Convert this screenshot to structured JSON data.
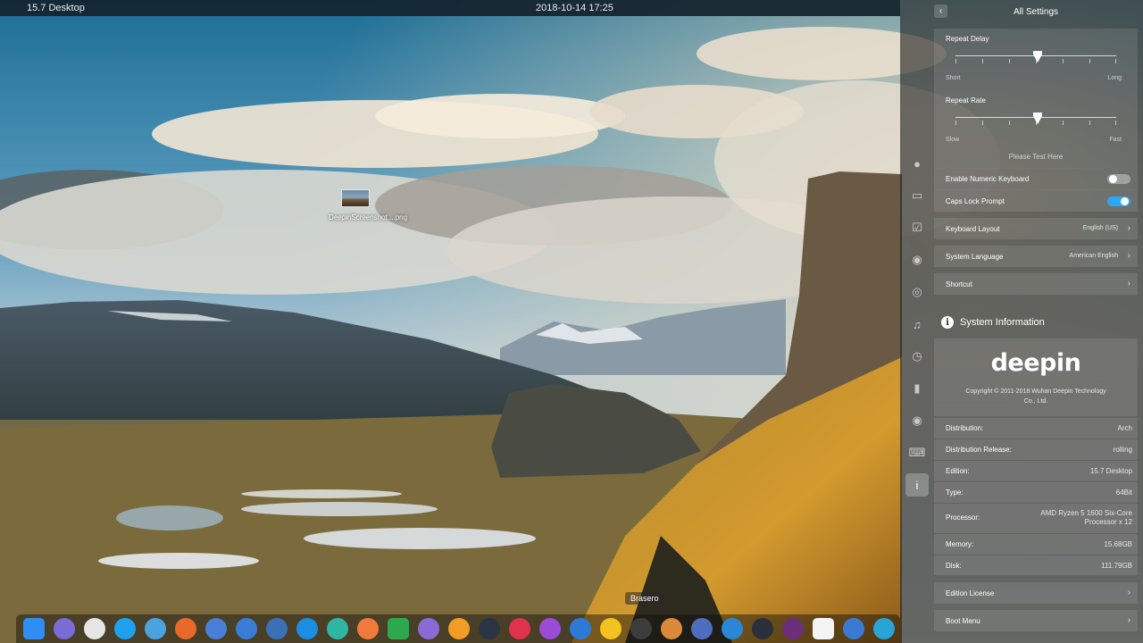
{
  "topbar": {
    "left_text": "15.7 Desktop",
    "datetime": "2018-10-14 17:25"
  },
  "desktop": {
    "file_icon_label": "DeepinScreenshot....png"
  },
  "dock": {
    "tooltip": "Brasero",
    "apps": [
      {
        "name": "launcher-icon",
        "color": "#2f8ef4"
      },
      {
        "name": "file-manager-icon",
        "color": "#7a6bd6"
      },
      {
        "name": "disc-icon",
        "color": "#e6e6e6"
      },
      {
        "name": "skype-icon",
        "color": "#1ea1f1"
      },
      {
        "name": "messenger-icon",
        "color": "#4aa3df"
      },
      {
        "name": "firefox-icon",
        "color": "#e8692a"
      },
      {
        "name": "chromium-icon",
        "color": "#4a7fd8"
      },
      {
        "name": "qbittorrent-icon",
        "color": "#3a7bd5"
      },
      {
        "name": "network-icon",
        "color": "#3b6fb6"
      },
      {
        "name": "teamviewer-icon",
        "color": "#1a8ee0"
      },
      {
        "name": "notes-icon",
        "color": "#2eb5a4"
      },
      {
        "name": "image-viewer-icon",
        "color": "#f07a3c"
      },
      {
        "name": "spreadsheet-icon",
        "color": "#2ea84d"
      },
      {
        "name": "document-icon",
        "color": "#8a6bd3"
      },
      {
        "name": "store-icon",
        "color": "#f39c25"
      },
      {
        "name": "kodi-icon",
        "color": "#2a3442"
      },
      {
        "name": "game-icon",
        "color": "#e0324a"
      },
      {
        "name": "music-player-icon",
        "color": "#9a4cd6"
      },
      {
        "name": "media-player-icon",
        "color": "#2c7ad6"
      },
      {
        "name": "video-icon",
        "color": "#f4c21f"
      },
      {
        "name": "brasero-icon",
        "color": "#3c3c3c"
      },
      {
        "name": "gimp-icon",
        "color": "#d88a3a"
      },
      {
        "name": "drawing-icon",
        "color": "#4e6dbd"
      },
      {
        "name": "cloud-icon",
        "color": "#2c86d6"
      },
      {
        "name": "steam-icon",
        "color": "#2a2f3a"
      },
      {
        "name": "podcast-icon",
        "color": "#6b2f7a"
      },
      {
        "name": "windows-app-icon",
        "color": "#f4f4f4"
      },
      {
        "name": "remote-desktop-icon",
        "color": "#3a7ad3"
      },
      {
        "name": "system-monitor-icon",
        "color": "#2aa4d6"
      }
    ]
  },
  "panel": {
    "back_icon": "chevron-left-icon",
    "title": "All Settings",
    "repeat_delay": {
      "label": "Repeat Delay",
      "min_label": "Short",
      "max_label": "Long",
      "level": 0.5
    },
    "repeat_rate": {
      "label": "Repeat Rate",
      "min_label": "Slow",
      "max_label": "Fast",
      "level": 0.5
    },
    "test_placeholder": "Please Test Here",
    "numeric_keyboard": {
      "label": "Enable Numeric Keyboard",
      "on": false
    },
    "caps_lock": {
      "label": "Caps Lock Prompt",
      "on": true
    },
    "keyboard_layout": {
      "label": "Keyboard Layout",
      "value": "English (US)"
    },
    "system_language": {
      "label": "System Language",
      "value": "American English"
    },
    "shortcut": {
      "label": "Shortcut"
    },
    "sysinfo_title": "System Information",
    "logo_text": "deepin",
    "copyright": "Copyright © 2011-2018 Wuhan Deepin Technology Co., Ltd.",
    "info_rows": [
      {
        "label": "Distribution:",
        "value": "Arch"
      },
      {
        "label": "Distribution Release:",
        "value": "rolling"
      },
      {
        "label": "Edition:",
        "value": "15.7 Desktop"
      },
      {
        "label": "Type:",
        "value": "64Bit"
      },
      {
        "label": "Processor:",
        "value": "AMD Ryzen 5 1600 Six-Core Processor x 12"
      },
      {
        "label": "Memory:",
        "value": "15.68GB"
      },
      {
        "label": "Disk:",
        "value": "111.79GB"
      }
    ],
    "edition_license": {
      "label": "Edition License"
    },
    "boot_menu": {
      "label": "Boot Menu"
    }
  },
  "side_icons": [
    "accounts-icon",
    "display-icon",
    "default-apps-icon",
    "personalization-icon",
    "network-icon",
    "sound-icon",
    "time-icon",
    "power-icon",
    "mouse-icon",
    "keyboard-icon",
    "system-info-icon"
  ],
  "colors": {
    "toggle_on": "#2ca7f8",
    "panel_bg": "rgba(30,30,30,0.62)"
  }
}
